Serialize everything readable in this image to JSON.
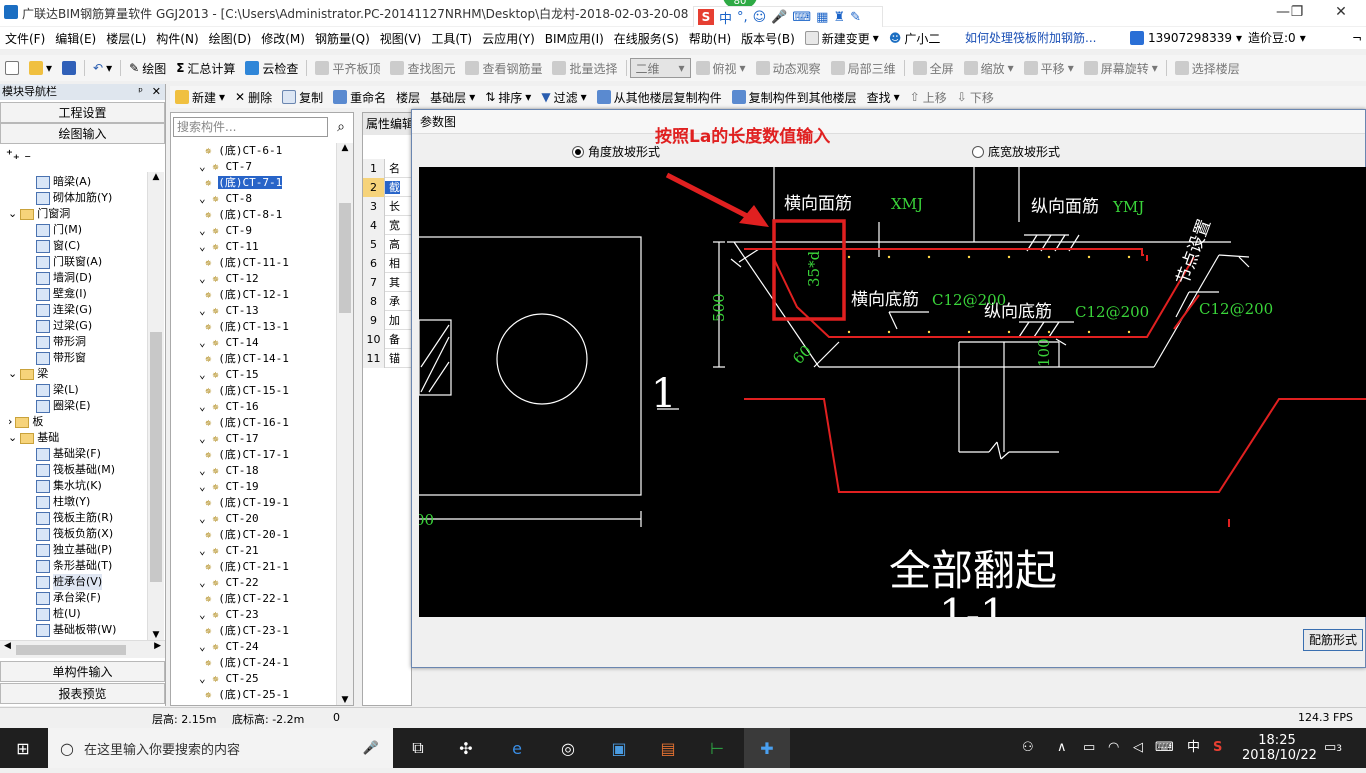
{
  "title": {
    "text": "广联达BIM钢筋算量软件 GGJ2013 - [C:\\Users\\Administrator.PC-20141127NRHM\\Desktop\\白龙村-2018-02-03-20-08",
    "badge": "80"
  },
  "ime": {
    "logo": "S",
    "lang": "中",
    "punct": "°,"
  },
  "menu": {
    "items": [
      "文件(F)",
      "编辑(E)",
      "楼层(L)",
      "构件(N)",
      "绘图(D)",
      "修改(M)",
      "钢筋量(Q)",
      "视图(V)",
      "工具(T)",
      "云应用(Y)",
      "BIM应用(I)",
      "在线服务(S)",
      "帮助(H)",
      "版本号(B)"
    ],
    "new_change": "新建变更",
    "assistant": "广小二",
    "question": "如何处理筏板附加钢筋...",
    "phone": "13907298339",
    "beans": "造价豆:0"
  },
  "toolbar1": {
    "draw": "绘图",
    "sum": "汇总计算",
    "cloud_check": "云检查",
    "flush": "平齐板顶",
    "find": "查找图元",
    "view_steel": "查看钢筋量",
    "batch": "批量选择",
    "view_mode": "二维",
    "top_view": "俯视",
    "dynamic": "动态观察",
    "local3d": "局部三维",
    "fullscreen": "全屏",
    "zoom": "缩放",
    "pan": "平移",
    "rotate": "屏幕旋转",
    "select_floor": "选择楼层"
  },
  "toolbar2": {
    "new": "新建",
    "delete": "删除",
    "copy": "复制",
    "rename": "重命名",
    "floor_label": "楼层",
    "floor_value": "基础层",
    "sort": "排序",
    "filter": "过滤",
    "copy_from": "从其他楼层复制构件",
    "copy_to": "复制构件到其他楼层",
    "find": "查找",
    "up": "上移",
    "down": "下移"
  },
  "nav": {
    "title": "模块导航栏",
    "project_settings": "工程设置",
    "drawing_input": "绘图输入",
    "single_input": "单构件输入",
    "report": "报表预览",
    "tree": [
      {
        "label": "暗梁(A)",
        "type": "item"
      },
      {
        "label": "砌体加筋(Y)",
        "type": "item"
      },
      {
        "label": "门窗洞",
        "type": "folder"
      },
      {
        "label": "门(M)",
        "type": "item"
      },
      {
        "label": "窗(C)",
        "type": "item"
      },
      {
        "label": "门联窗(A)",
        "type": "item"
      },
      {
        "label": "墙洞(D)",
        "type": "item"
      },
      {
        "label": "壁龛(I)",
        "type": "item"
      },
      {
        "label": "连梁(G)",
        "type": "item"
      },
      {
        "label": "过梁(G)",
        "type": "item"
      },
      {
        "label": "带形洞",
        "type": "item"
      },
      {
        "label": "带形窗",
        "type": "item"
      },
      {
        "label": "梁",
        "type": "folder"
      },
      {
        "label": "梁(L)",
        "type": "item"
      },
      {
        "label": "圈梁(E)",
        "type": "item"
      },
      {
        "label": "板",
        "type": "folder"
      },
      {
        "label": "基础",
        "type": "folder"
      },
      {
        "label": "基础梁(F)",
        "type": "item"
      },
      {
        "label": "筏板基础(M)",
        "type": "item"
      },
      {
        "label": "集水坑(K)",
        "type": "item"
      },
      {
        "label": "柱墩(Y)",
        "type": "item"
      },
      {
        "label": "筏板主筋(R)",
        "type": "item"
      },
      {
        "label": "筏板负筋(X)",
        "type": "item"
      },
      {
        "label": "独立基础(P)",
        "type": "item"
      },
      {
        "label": "条形基础(T)",
        "type": "item"
      },
      {
        "label": "桩承台(V)",
        "type": "item"
      },
      {
        "label": "承台梁(F)",
        "type": "item"
      },
      {
        "label": "桩(U)",
        "type": "item"
      },
      {
        "label": "基础板带(W)",
        "type": "item"
      }
    ]
  },
  "list": {
    "search_placeholder": "搜索构件...",
    "items": [
      "(底)CT-6-1",
      "CT-7",
      "(底)CT-7-1",
      "CT-8",
      "(底)CT-8-1",
      "CT-9",
      "CT-11",
      "(底)CT-11-1",
      "CT-12",
      "(底)CT-12-1",
      "CT-13",
      "(底)CT-13-1",
      "CT-14",
      "(底)CT-14-1",
      "CT-15",
      "(底)CT-15-1",
      "CT-16",
      "(底)CT-16-1",
      "CT-17",
      "(底)CT-17-1",
      "CT-18",
      "CT-19",
      "(底)CT-19-1",
      "CT-20",
      "(底)CT-20-1",
      "CT-21",
      "(底)CT-21-1",
      "CT-22",
      "(底)CT-22-1",
      "CT-23",
      "(底)CT-23-1",
      "CT-24",
      "(底)CT-24-1",
      "CT-25",
      "(底)CT-25-1"
    ],
    "selected": "(底)CT-7-1"
  },
  "props": {
    "title": "属性编辑",
    "rows": [
      {
        "n": "1",
        "v": "名"
      },
      {
        "n": "2",
        "v": "截"
      },
      {
        "n": "3",
        "v": "长"
      },
      {
        "n": "4",
        "v": "宽"
      },
      {
        "n": "5",
        "v": "高"
      },
      {
        "n": "6",
        "v": "相"
      },
      {
        "n": "7",
        "v": "其"
      },
      {
        "n": "8",
        "v": "承"
      },
      {
        "n": "9",
        "v": "加"
      },
      {
        "n": "10",
        "v": "备"
      },
      {
        "n": "11",
        "v": "锚"
      }
    ]
  },
  "dialog": {
    "title": "参数图",
    "annotation": "按照La的长度数值输入",
    "radio_angle": "角度放坡形式",
    "radio_bottom": "底宽放坡形式",
    "button": "配筋形式",
    "drawing": {
      "h_top": "横向面筋",
      "h_top_code": "XMJ",
      "v_top": "纵向面筋",
      "v_top_code": "YMJ",
      "node": "节点设置",
      "anchor": "35*d",
      "h_bottom": "横向底筋",
      "h_bottom_code": "C12@200",
      "v_bottom": "纵向底筋",
      "v_bottom_code": "C12@200",
      "side_code": "C12@200",
      "dim_500": "500",
      "dim_60": "60",
      "dim_100": "100",
      "dim_00": "00",
      "section_no": "1",
      "all_up": "全部翻起",
      "section_bottom": "1-1"
    }
  },
  "status": {
    "floor_height": "层高: 2.15m",
    "bottom_elev": "底标高: -2.2m",
    "zero": "0",
    "fps": "124.3 FPS"
  },
  "taskbar": {
    "search": "在这里输入你要搜索的内容",
    "lang": "中",
    "time": "18:25",
    "date": "2018/10/22",
    "notif": "3"
  },
  "colors": {
    "accent": "#2864c8",
    "annotation_red": "#e02020",
    "drawing_green": "#3ad43a",
    "drawing_bg": "#000000"
  }
}
